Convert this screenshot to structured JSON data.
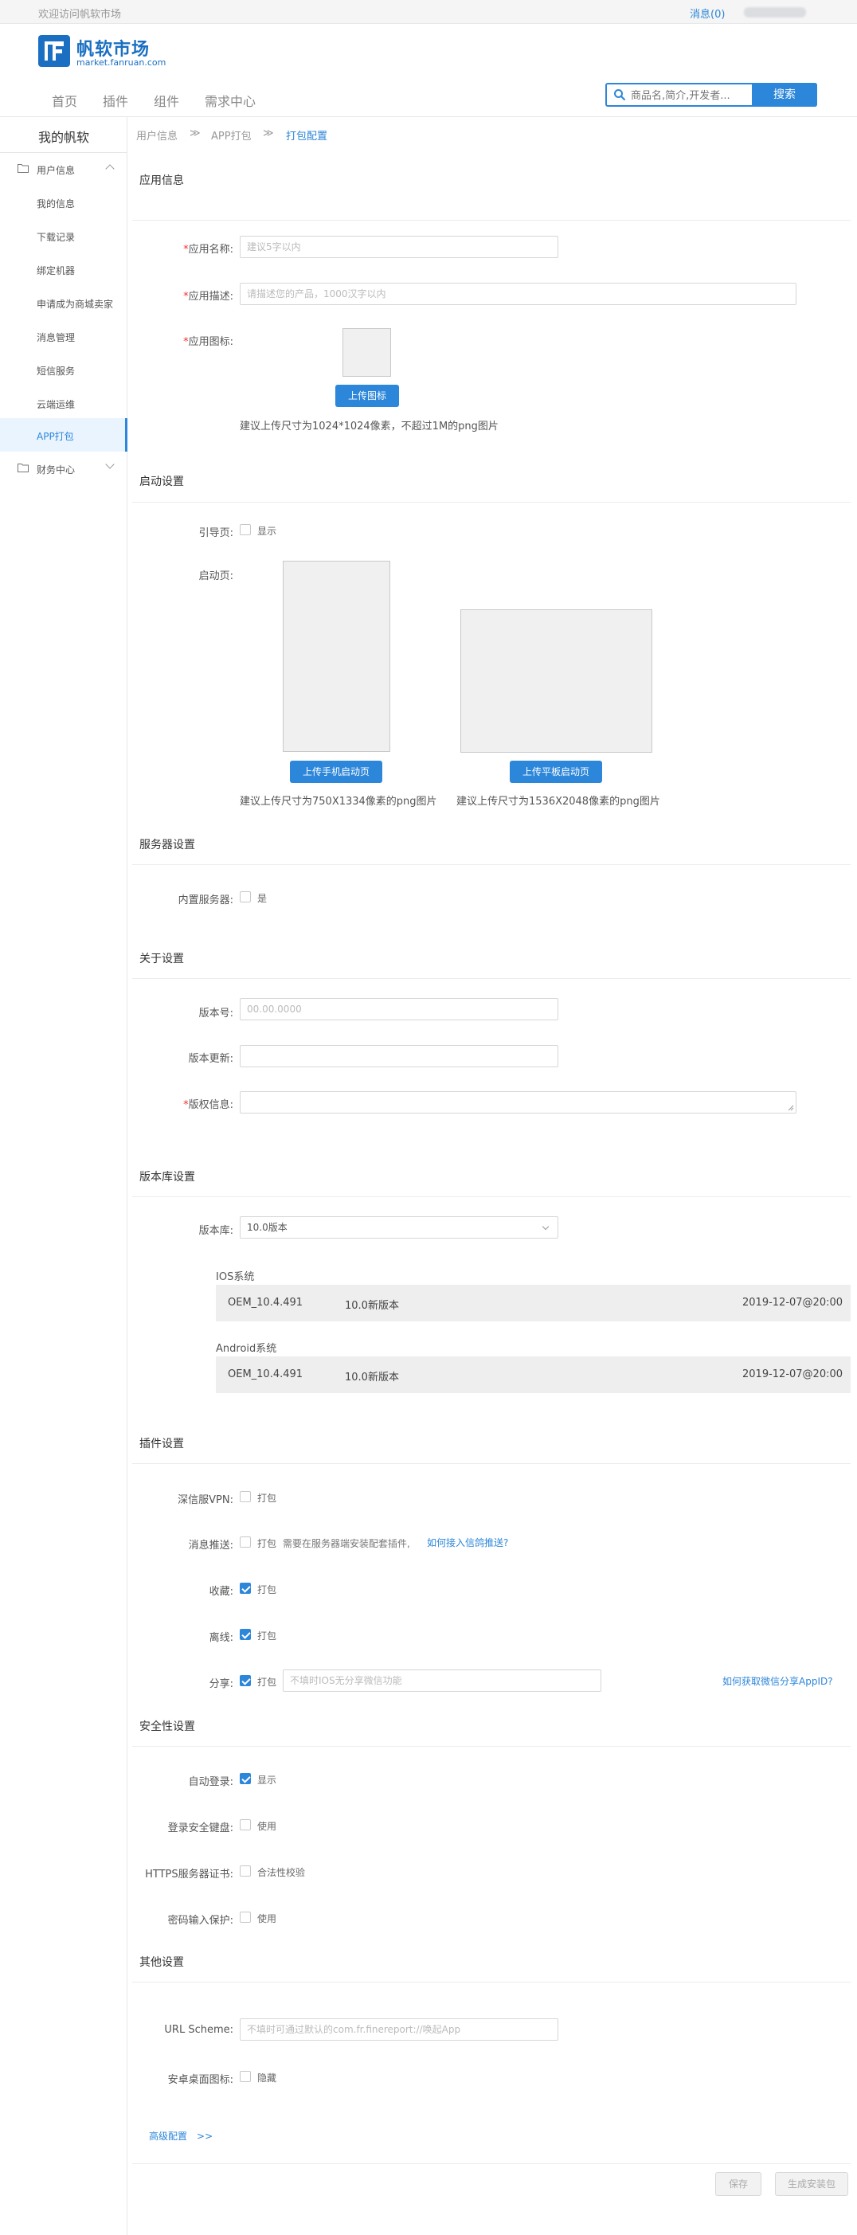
{
  "topbar": {
    "welcome": "欢迎访问帆软市场",
    "messages": "消息(0)"
  },
  "header": {
    "brand": "帆软市场",
    "brand_sub": "market.fanruan.com",
    "nav": [
      "首页",
      "插件",
      "组件",
      "需求中心"
    ],
    "search_placeholder": "商品名,简介,开发者...",
    "search_button": "搜索"
  },
  "sidebar": {
    "title": "我的帆软",
    "groups": [
      {
        "label": "用户信息",
        "expanded": true
      },
      {
        "label": "财务中心",
        "expanded": false
      }
    ],
    "items": [
      "我的信息",
      "下载记录",
      "绑定机器",
      "申请成为商城卖家",
      "消息管理",
      "短信服务",
      "云端运维",
      "APP打包"
    ],
    "active_item": "APP打包"
  },
  "breadcrumb": [
    "用户信息",
    "APP打包",
    "打包配置"
  ],
  "app_info": {
    "title": "应用信息",
    "name_label": "应用名称:",
    "name_placeholder": "建议5字以内",
    "desc_label": "应用描述:",
    "desc_placeholder": "请描述您的产品，1000汉字以内",
    "icon_label": "应用图标:",
    "upload_icon": "上传图标",
    "icon_hint": "建议上传尺寸为1024*1024像素，不超过1M的png图片"
  },
  "startup": {
    "title": "启动设置",
    "guide_label": "引导页:",
    "guide_option": "显示",
    "splash_label": "启动页:",
    "upload_phone": "上传手机启动页",
    "upload_pad": "上传平板启动页",
    "phone_hint": "建议上传尺寸为750X1334像素的png图片",
    "pad_hint": "建议上传尺寸为1536X2048像素的png图片"
  },
  "server": {
    "title": "服务器设置",
    "builtin_label": "内置服务器:",
    "builtin_option": "是"
  },
  "about": {
    "title": "关于设置",
    "version_label": "版本号:",
    "version_placeholder": "00.00.0000",
    "update_label": "版本更新:",
    "copyright_label": "版权信息:"
  },
  "repo": {
    "title": "版本库设置",
    "repo_label": "版本库:",
    "repo_value": "10.0版本",
    "ios_title": "IOS系统",
    "android_title": "Android系统",
    "ios": {
      "oem": "OEM_10.4.491",
      "version": "10.0新版本",
      "date": "2019-12-07@20:00"
    },
    "android": {
      "oem": "OEM_10.4.491",
      "version": "10.0新版本",
      "date": "2019-12-07@20:00"
    }
  },
  "plugins": {
    "title": "插件设置",
    "vpn_label": "深信服VPN:",
    "push_label": "消息推送:",
    "push_note": "需要在服务器端安装配套插件,",
    "push_link": "如何接入信鸽推送?",
    "fav_label": "收藏:",
    "offline_label": "离线:",
    "share_label": "分享:",
    "share_placeholder": "不填时IOS无分享微信功能",
    "share_link": "如何获取微信分享AppID?",
    "pack": "打包",
    "vpn_checked": false,
    "push_checked": false,
    "fav_checked": true,
    "offline_checked": true,
    "share_checked": true
  },
  "security": {
    "title": "安全性设置",
    "autologin_label": "自动登录:",
    "autologin_option": "显示",
    "keyboard_label": "登录安全键盘:",
    "keyboard_option": "使用",
    "https_label": "HTTPS服务器证书:",
    "https_option": "合法性校验",
    "pwd_label": "密码输入保护:",
    "pwd_option": "使用",
    "autologin_checked": true
  },
  "other": {
    "title": "其他设置",
    "scheme_label": "URL Scheme:",
    "scheme_placeholder": "不填时可通过默认的com.fr.finereport://唤起App",
    "desk_label": "安卓桌面图标:",
    "desk_option": "隐藏",
    "advanced": "高级配置",
    "advanced_arrow": ">>"
  },
  "actions": {
    "save": "保存",
    "build": "生成安装包"
  },
  "colors": {
    "accent": "#2c86d9",
    "required": "#e33333"
  }
}
